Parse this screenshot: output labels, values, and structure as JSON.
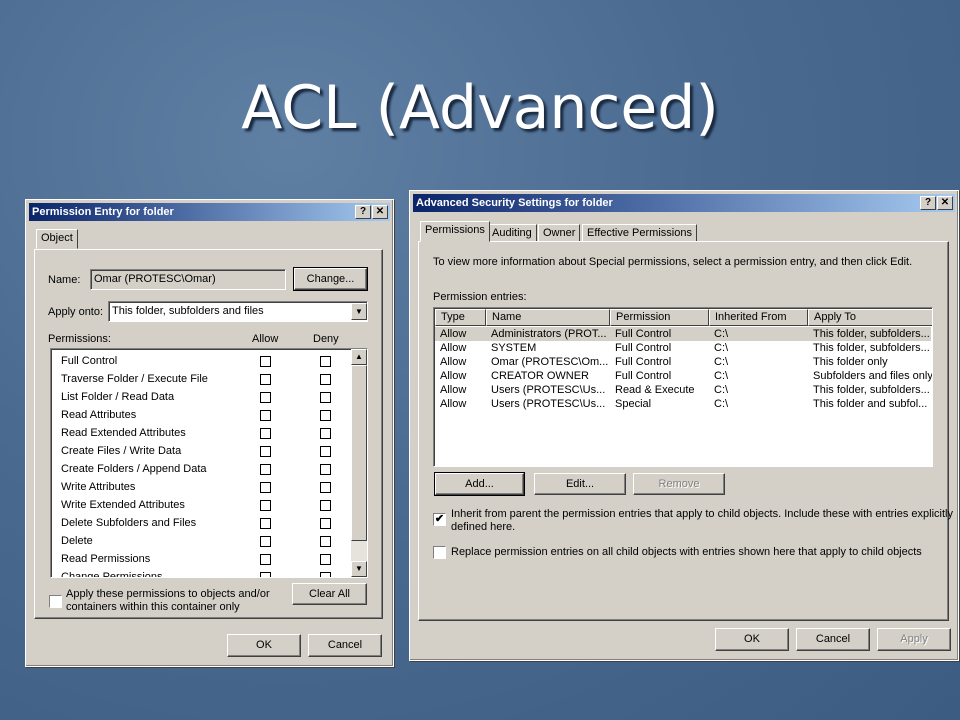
{
  "slide": {
    "title": "ACL (Advanced)"
  },
  "perm_entry": {
    "title": "Permission Entry for folder",
    "help_glyph": "?",
    "close_glyph": "✕",
    "tab_object": "Object",
    "name_label": "Name:",
    "name_value": "Omar (PROTESC\\Omar)",
    "change_button": "Change...",
    "apply_onto_label": "Apply onto:",
    "apply_onto_value": "This folder, subfolders and files",
    "permissions_label": "Permissions:",
    "allow_header": "Allow",
    "deny_header": "Deny",
    "permissions": [
      "Full Control",
      "Traverse Folder / Execute File",
      "List Folder / Read Data",
      "Read Attributes",
      "Read Extended Attributes",
      "Create Files / Write Data",
      "Create Folders / Append Data",
      "Write Attributes",
      "Write Extended Attributes",
      "Delete Subfolders and Files",
      "Delete",
      "Read Permissions",
      "Change Permissions"
    ],
    "apply_children_text_1": "Apply these permissions to objects and/or",
    "apply_children_text_2": "containers within this container only",
    "clear_all_button": "Clear All",
    "ok_button": "OK",
    "cancel_button": "Cancel"
  },
  "adv_security": {
    "title": "Advanced Security Settings for folder",
    "help_glyph": "?",
    "close_glyph": "✕",
    "tabs": [
      "Permissions",
      "Auditing",
      "Owner",
      "Effective Permissions"
    ],
    "info_text": "To view more information about Special permissions, select a permission entry, and then click Edit.",
    "entries_label": "Permission entries:",
    "columns": [
      "Type",
      "Name",
      "Permission",
      "Inherited From",
      "Apply To"
    ],
    "rows": [
      [
        "Allow",
        "Administrators (PROT...",
        "Full Control",
        "C:\\",
        "This folder, subfolders..."
      ],
      [
        "Allow",
        "SYSTEM",
        "Full Control",
        "C:\\",
        "This folder, subfolders..."
      ],
      [
        "Allow",
        "Omar (PROTESC\\Om...",
        "Full Control",
        "C:\\",
        "This folder only"
      ],
      [
        "Allow",
        "CREATOR OWNER",
        "Full Control",
        "C:\\",
        "Subfolders and files only"
      ],
      [
        "Allow",
        "Users (PROTESC\\Us...",
        "Read & Execute",
        "C:\\",
        "This folder, subfolders..."
      ],
      [
        "Allow",
        "Users (PROTESC\\Us...",
        "Special",
        "C:\\",
        "This folder and subfol..."
      ]
    ],
    "add_button": "Add...",
    "edit_button": "Edit...",
    "remove_button": "Remove",
    "inherit_text_1": "Inherit from parent the permission entries that apply to child objects. Include these with entries explicitly",
    "inherit_text_2": "defined here.",
    "inherit_checked": "✔",
    "replace_text": "Replace permission entries on all child objects with entries shown here that apply to child objects",
    "ok_button": "OK",
    "cancel_button": "Cancel",
    "apply_button": "Apply"
  }
}
